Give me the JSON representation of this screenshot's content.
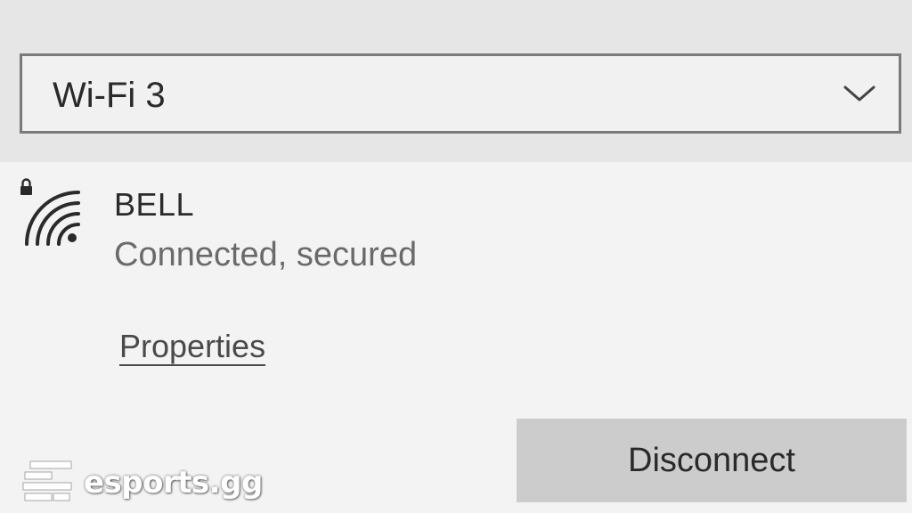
{
  "adapter_select": {
    "selected": "Wi-Fi 3",
    "chevron_icon": "chevron-down-icon"
  },
  "network": {
    "name": "BELL",
    "status": "Connected, secured",
    "icon": "wifi-secured-icon"
  },
  "actions": {
    "properties_label": "Properties",
    "disconnect_label": "Disconnect"
  },
  "watermark": {
    "text": "esports.gg",
    "icon": "esports-logo-icon"
  },
  "colors": {
    "top_band": "#e6e6e6",
    "panel": "#f3f3f3",
    "dropdown_border": "#7a7a7a",
    "button_bg": "#cccccc",
    "status_text": "#6a6a6a"
  }
}
